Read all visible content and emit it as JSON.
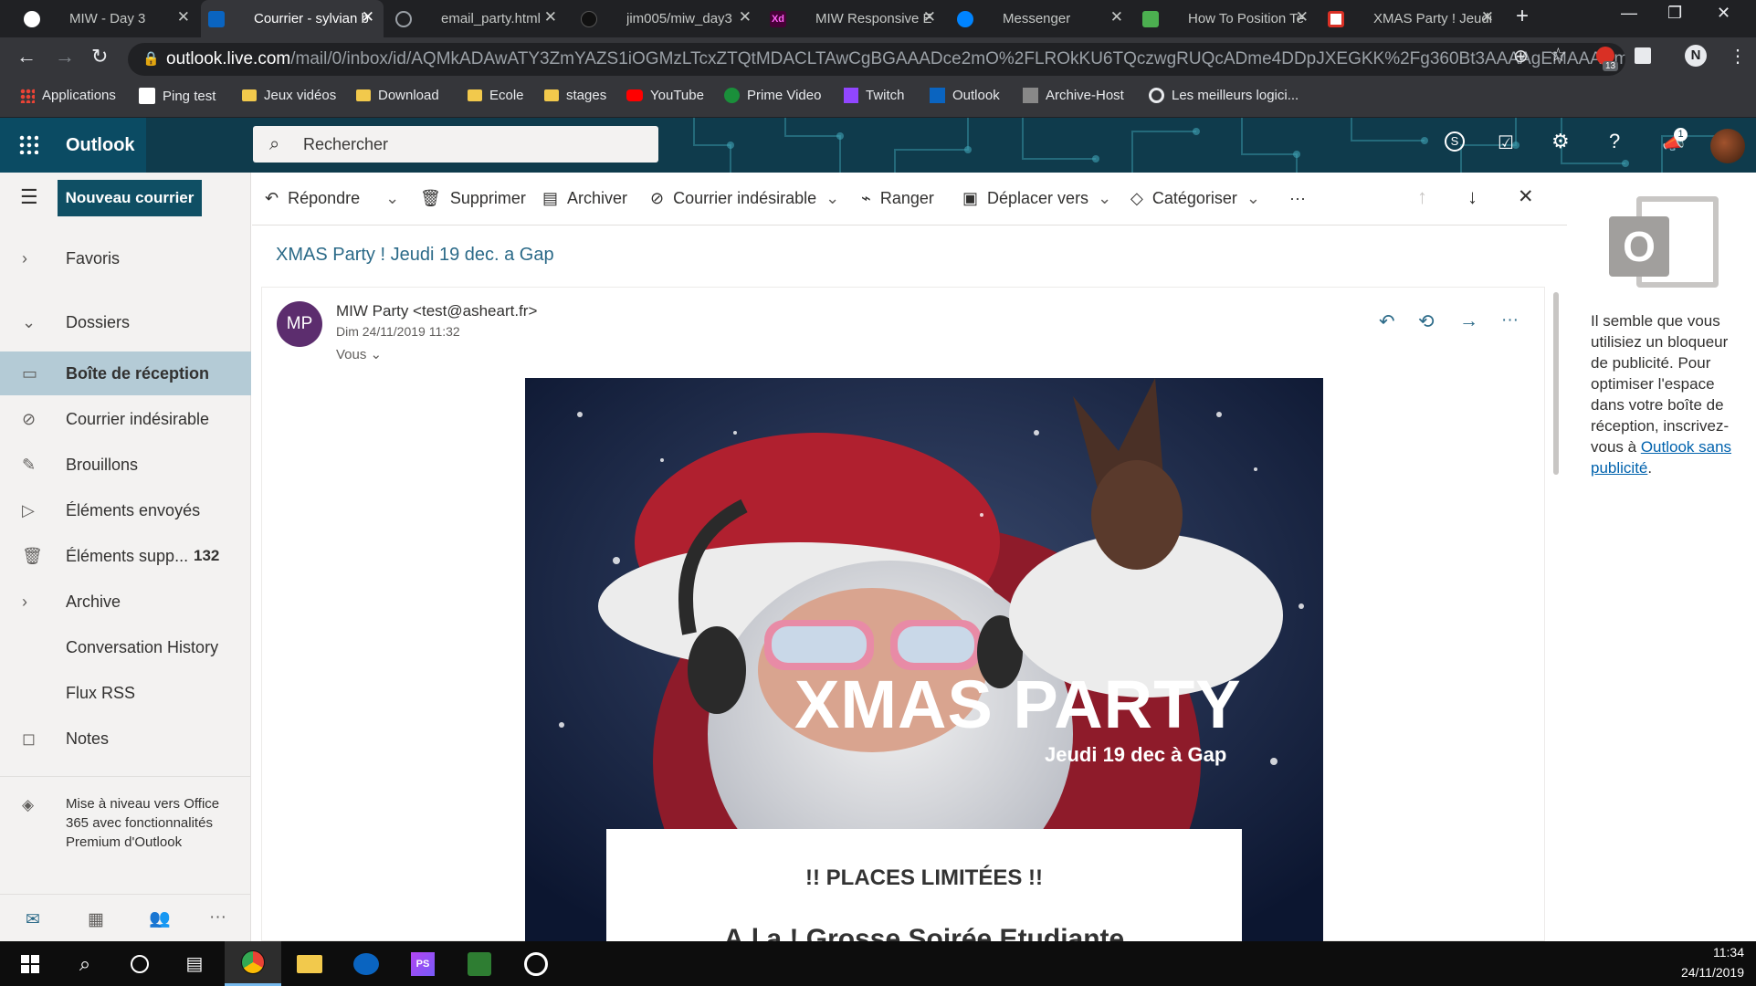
{
  "browser": {
    "tabs": [
      {
        "label": "MIW - Day 3",
        "icon": "github-icon"
      },
      {
        "label": "Courrier - sylvian b",
        "icon": "outlook-icon",
        "active": true
      },
      {
        "label": "email_party.html",
        "icon": "globe-icon"
      },
      {
        "label": "jim005/miw_day3",
        "icon": "github-icon"
      },
      {
        "label": "MIW Responsive E",
        "icon": "xd-icon"
      },
      {
        "label": "Messenger",
        "icon": "messenger-icon"
      },
      {
        "label": "How To Position Te",
        "icon": "codepen-icon"
      },
      {
        "label": "XMAS Party ! Jeudi",
        "icon": "gmail-icon"
      }
    ],
    "address": {
      "host": "outlook.live.com",
      "path": "/mail/0/inbox/id/AQMkADAwATY3ZmYAZS1iOGMzLTcxZTQtMDACLTAwCgBGAAADce2mO%2FLROkKU6TQczwgRUQcADme4DDpJXEGKK%2Fg360Bt3AAAAgEMAAADme..."
    },
    "extension_badge": "13",
    "bookmarks": [
      "Applications",
      "Ping test",
      "Jeux vidéos",
      "Download",
      "Ecole",
      "stages",
      "YouTube",
      "Prime Video",
      "Twitch",
      "Outlook",
      "Archive-Host",
      "Les meilleurs logici..."
    ]
  },
  "outlook": {
    "brand": "Outlook",
    "search_placeholder": "Rechercher",
    "notification_count": "1",
    "new_mail": "Nouveau courrier",
    "toolbar": {
      "reply": "Répondre",
      "delete": "Supprimer",
      "archive": "Archiver",
      "junk": "Courrier indésirable",
      "sweep": "Ranger",
      "move": "Déplacer vers",
      "categorize": "Catégoriser",
      "more": "···"
    },
    "nav": {
      "favorites": "Favoris",
      "folders": "Dossiers",
      "items": [
        {
          "label": "Boîte de réception",
          "icon": "inbox-icon",
          "selected": true
        },
        {
          "label": "Courrier indésirable",
          "icon": "blocked-icon"
        },
        {
          "label": "Brouillons",
          "icon": "pencil-icon"
        },
        {
          "label": "Éléments envoyés",
          "icon": "send-icon"
        },
        {
          "label": "Éléments supp...",
          "icon": "trash-icon",
          "count": "132"
        },
        {
          "label": "Archive",
          "icon": "chevron-right-icon"
        },
        {
          "label": "Conversation History",
          "icon": ""
        },
        {
          "label": "Flux RSS",
          "icon": ""
        },
        {
          "label": "Notes",
          "icon": "note-icon"
        }
      ],
      "upgrade": "Mise à niveau vers Office 365 avec fonctionnalités Premium d'Outlook"
    },
    "message": {
      "subject": "XMAS Party ! Jeudi 19 dec. a Gap",
      "initials": "MP",
      "from": "MIW Party <test@asheart.fr>",
      "date": "Dim 24/11/2019 11:32",
      "to": "Vous",
      "hero_title": "XMAS PARTY",
      "hero_subtitle": "Jeudi 19 dec à Gap",
      "box_title": "!! PLACES LIMITÉES !!",
      "box_line": "A.l.a ! Grosse Soirée Etudiante"
    },
    "ad_text": "Il semble que vous utilisiez un bloqueur de publicité. Pour optimiser l'espace dans votre boîte de réception, inscrivez-vous à ",
    "ad_link": "Outlook sans publicité",
    "ad_end": "."
  },
  "taskbar": {
    "time": "11:34",
    "date": "24/11/2019"
  }
}
